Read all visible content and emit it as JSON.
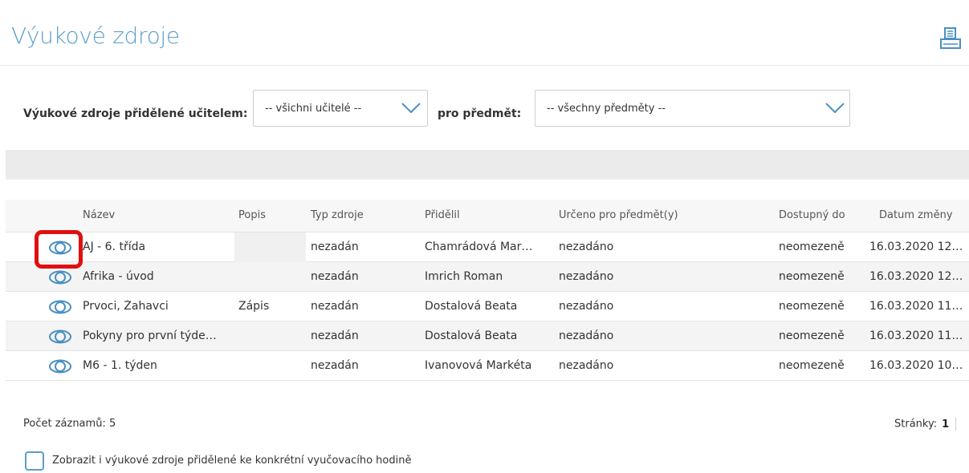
{
  "page": {
    "title": "Výukové zdroje",
    "print_icon": "printer-icon"
  },
  "filters": {
    "teacher_label": "Výukové zdroje přidělené učitelem:",
    "teacher_value": "-- všichni učitelé --",
    "subject_label": "pro předmět:",
    "subject_value": "-- všechny předměty --",
    "dropdown_icon": "chevron-down-icon"
  },
  "table": {
    "columns": [
      "Název",
      "Popis",
      "Typ zdroje",
      "Přidělil",
      "Určeno pro předmět(y)",
      "Dostupný do",
      "Datum změny"
    ],
    "view_icon": "eye-icon",
    "rows": [
      {
        "name": "AJ - 6. třída",
        "desc": "",
        "type": "nezadán",
        "assigned_by": "Chamrádová Mar…",
        "subject": "nezadáno",
        "available": "neomezeně",
        "changed": "16.03.2020 12…"
      },
      {
        "name": "Afrika - úvod",
        "desc": "",
        "type": "nezadán",
        "assigned_by": "Imrich Roman",
        "subject": "nezadáno",
        "available": "neomezeně",
        "changed": "16.03.2020 12…"
      },
      {
        "name": "Prvoci, Žahavci",
        "desc": "Zápis",
        "type": "nezadán",
        "assigned_by": "Dostalová Beata",
        "subject": "nezadáno",
        "available": "neomezeně",
        "changed": "16.03.2020 11…"
      },
      {
        "name": "Pokyny pro první týde…",
        "desc": "",
        "type": "nezadán",
        "assigned_by": "Dostalová Beata",
        "subject": "nezadáno",
        "available": "neomezeně",
        "changed": "16.03.2020 11…"
      },
      {
        "name": "M6 - 1. týden",
        "desc": "",
        "type": "nezadán",
        "assigned_by": "Ivanovová Markéta",
        "subject": "nezadáno",
        "available": "neomezeně",
        "changed": "16.03.2020 10…"
      }
    ]
  },
  "footer": {
    "count_text": "Počet záznamů: 5",
    "pages_label": "Stránky:",
    "current_page": "1",
    "checkbox_label": "Zobrazit i výukové zdroje přidělené ke konkrétní vyučovacího hodině"
  },
  "colors": {
    "accent": "#5b9ec9",
    "highlight": "#e01010"
  }
}
